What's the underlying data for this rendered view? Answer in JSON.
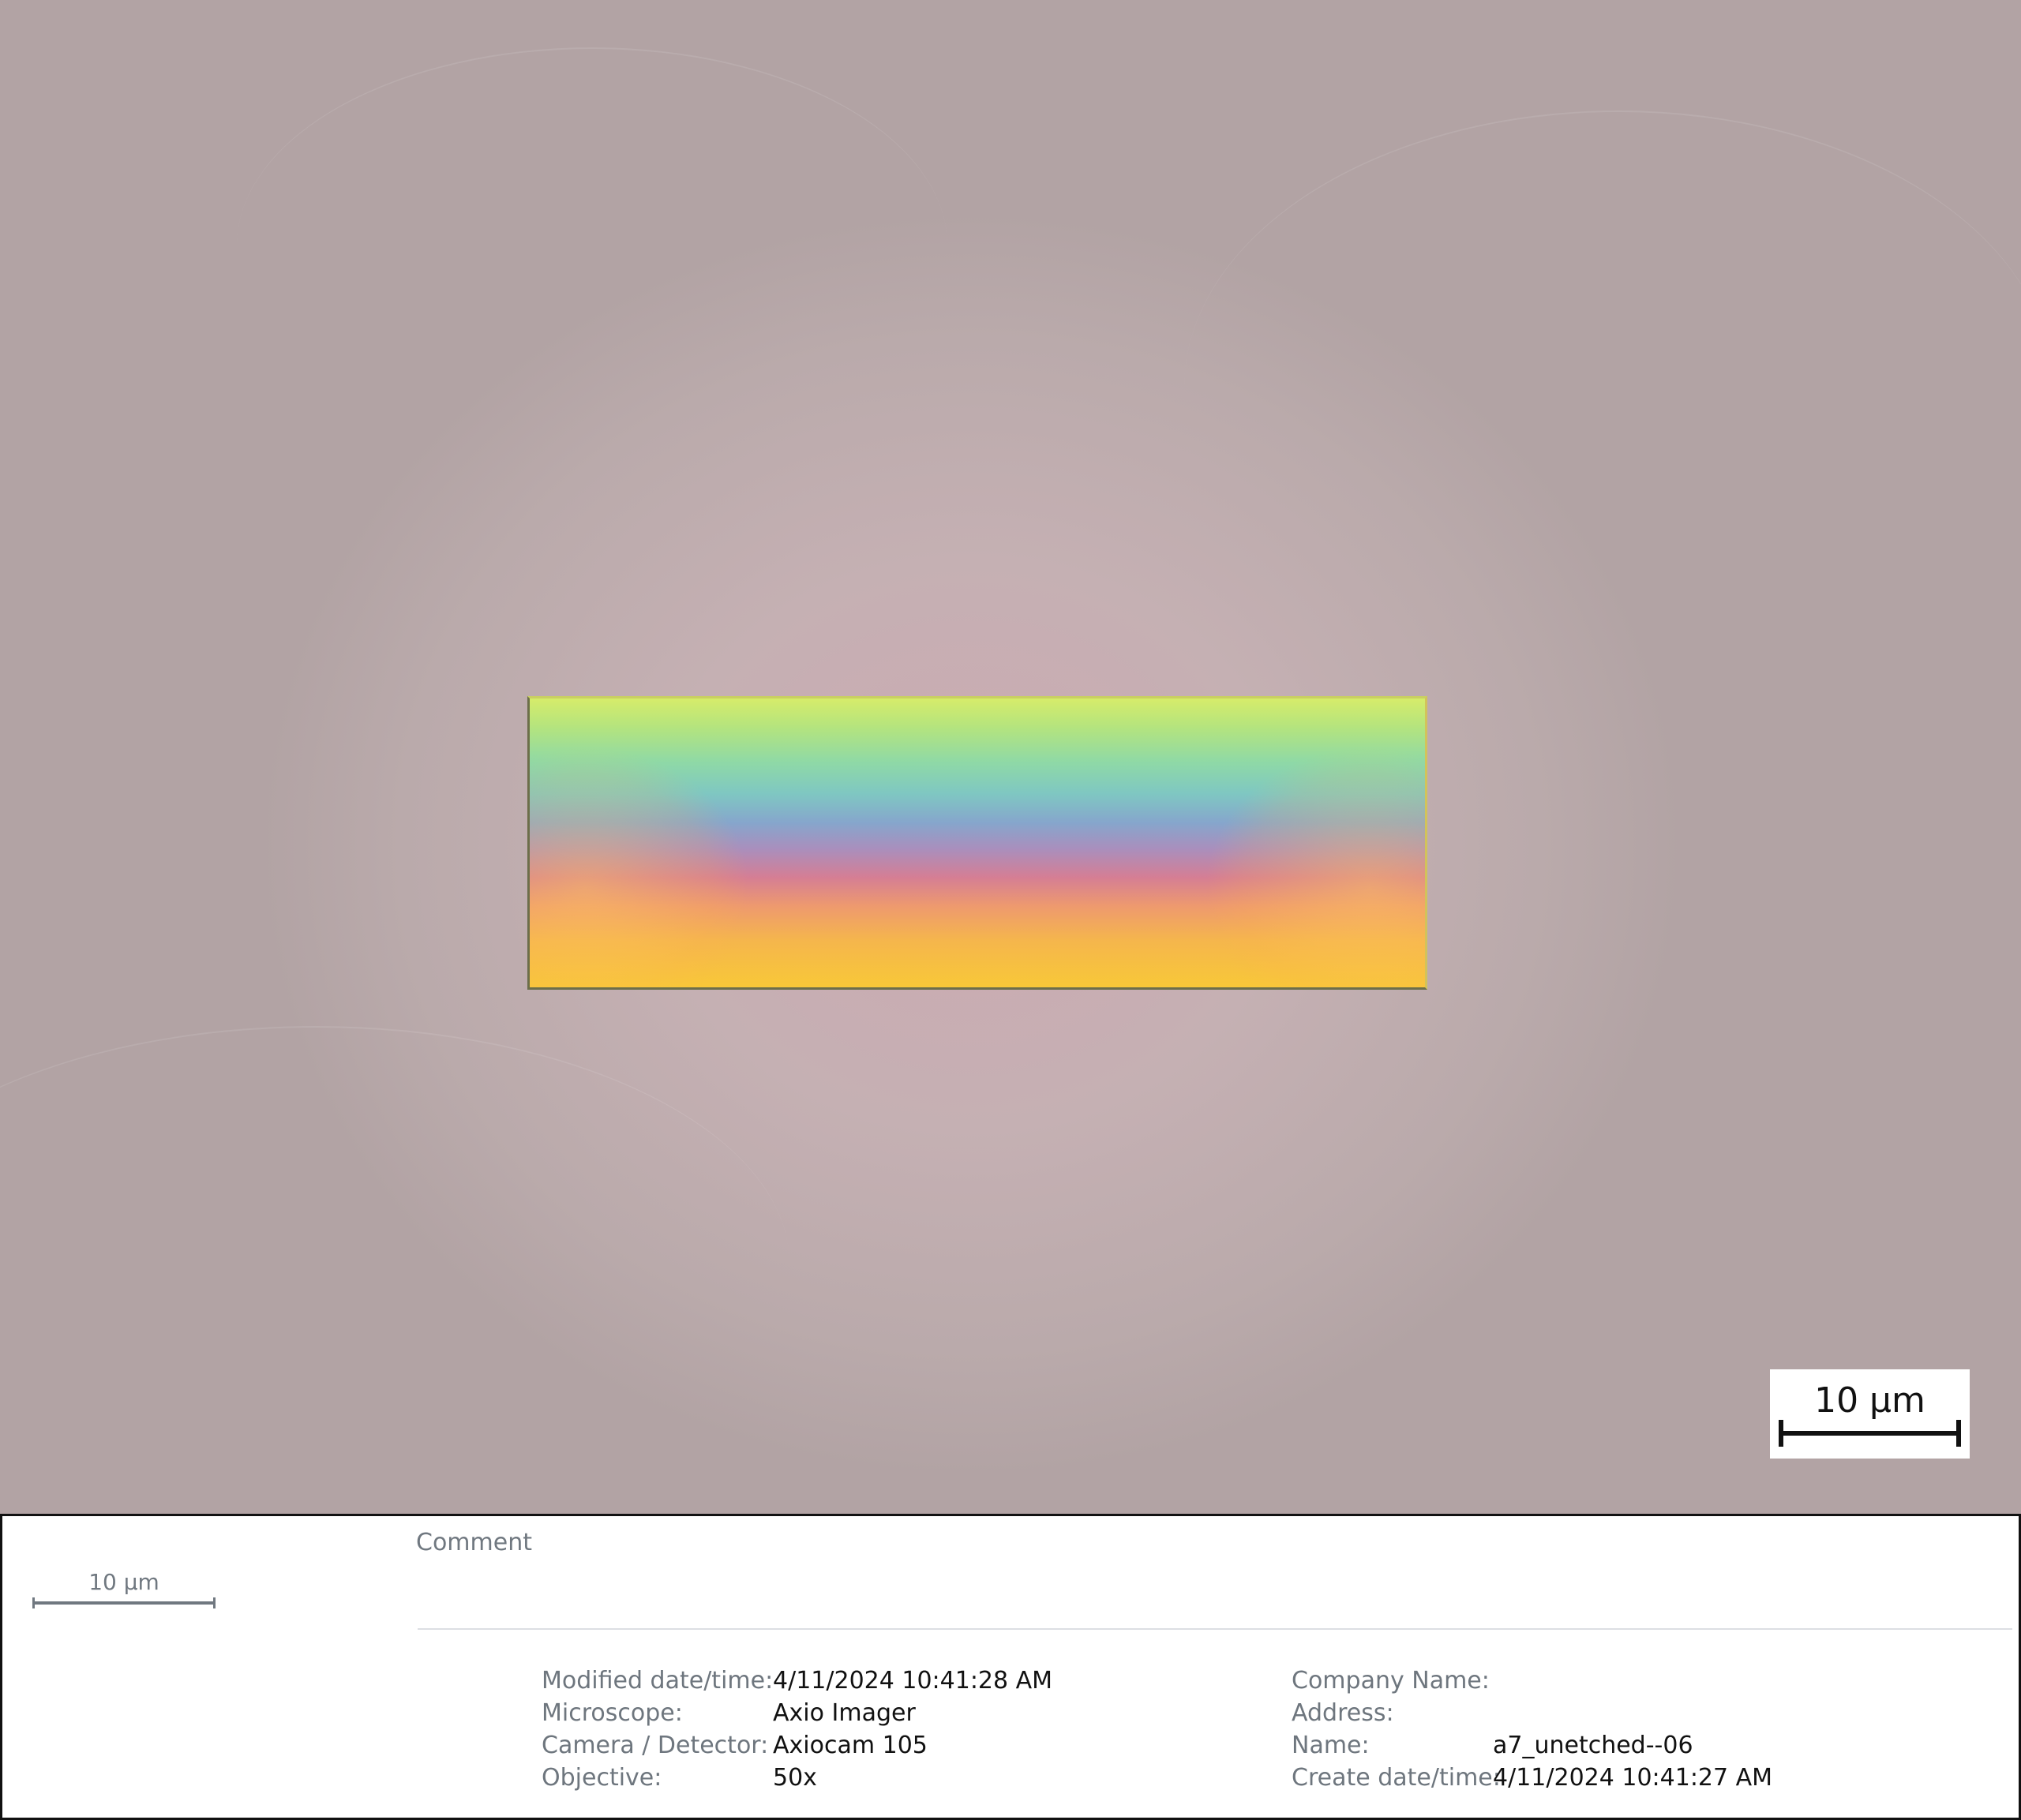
{
  "image": {
    "scale_bar_label": "10 µm",
    "colors": {
      "background": "#c5b0b3",
      "flake_top": "#d6ec6a",
      "flake_middle": "#86a6cc",
      "flake_bottom": "#f8c838"
    }
  },
  "panel": {
    "scale_label": "10 µm",
    "comment_label": "Comment",
    "left_meta": [
      {
        "key": "Modified date/time:",
        "value": "4/11/2024 10:41:28 AM"
      },
      {
        "key": "Microscope:",
        "value": "Axio Imager"
      },
      {
        "key": "Camera / Detector:",
        "value": "Axiocam 105"
      },
      {
        "key": "Objective:",
        "value": "50x"
      }
    ],
    "right_meta": [
      {
        "key": "Company Name:",
        "value": ""
      },
      {
        "key": "Address:",
        "value": ""
      },
      {
        "key": "Name:",
        "value": "a7_unetched--06"
      },
      {
        "key": "Create date/time:",
        "value": "4/11/2024 10:41:27 AM"
      }
    ]
  }
}
